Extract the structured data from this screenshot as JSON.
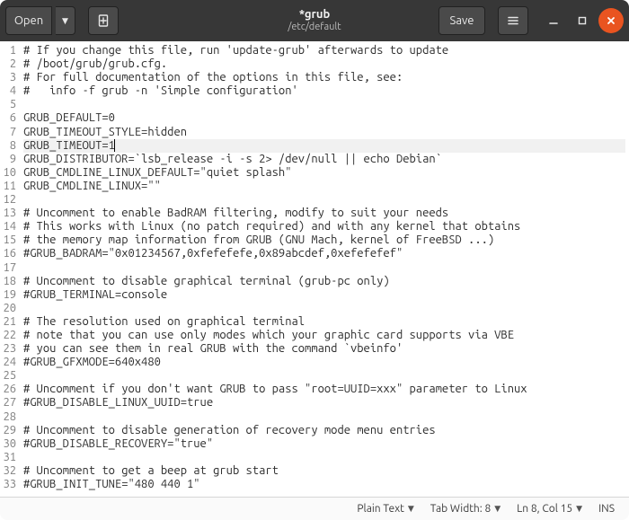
{
  "header": {
    "open_label": "Open",
    "save_label": "Save",
    "title": "*grub",
    "subtitle": "/etc/default"
  },
  "editor": {
    "cursor_line": 8,
    "lines": [
      "# If you change this file, run 'update-grub' afterwards to update",
      "# /boot/grub/grub.cfg.",
      "# For full documentation of the options in this file, see:",
      "#   info -f grub -n 'Simple configuration'",
      "",
      "GRUB_DEFAULT=0",
      "GRUB_TIMEOUT_STYLE=hidden",
      "GRUB_TIMEOUT=1",
      "GRUB_DISTRIBUTOR=`lsb_release -i -s 2> /dev/null || echo Debian`",
      "GRUB_CMDLINE_LINUX_DEFAULT=\"quiet splash\"",
      "GRUB_CMDLINE_LINUX=\"\"",
      "",
      "# Uncomment to enable BadRAM filtering, modify to suit your needs",
      "# This works with Linux (no patch required) and with any kernel that obtains",
      "# the memory map information from GRUB (GNU Mach, kernel of FreeBSD ...)",
      "#GRUB_BADRAM=\"0x01234567,0xfefefefe,0x89abcdef,0xefefefef\"",
      "",
      "# Uncomment to disable graphical terminal (grub-pc only)",
      "#GRUB_TERMINAL=console",
      "",
      "# The resolution used on graphical terminal",
      "# note that you can use only modes which your graphic card supports via VBE",
      "# you can see them in real GRUB with the command `vbeinfo'",
      "#GRUB_GFXMODE=640x480",
      "",
      "# Uncomment if you don't want GRUB to pass \"root=UUID=xxx\" parameter to Linux",
      "#GRUB_DISABLE_LINUX_UUID=true",
      "",
      "# Uncomment to disable generation of recovery mode menu entries",
      "#GRUB_DISABLE_RECOVERY=\"true\"",
      "",
      "# Uncomment to get a beep at grub start",
      "#GRUB_INIT_TUNE=\"480 440 1\""
    ]
  },
  "status": {
    "syntax": "Plain Text",
    "tab_width_label": "Tab Width: 8",
    "position": "Ln 8, Col 15",
    "insert_mode": "INS"
  }
}
